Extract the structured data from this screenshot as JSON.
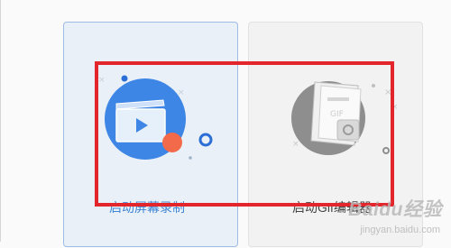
{
  "cards": [
    {
      "label": "启动屏幕录制",
      "icon": "video-clapper-icon",
      "accent": "#3d86e5",
      "dot": "#f26a4a",
      "active": true
    },
    {
      "label": "启动Gif编辑器",
      "icon": "gif-document-icon",
      "accent": "#8e8e8e",
      "active": false
    }
  ],
  "highlight_color": "#e3262b",
  "watermark": {
    "text": "Baidu经验",
    "sub": "jingyan.baidu.com"
  }
}
